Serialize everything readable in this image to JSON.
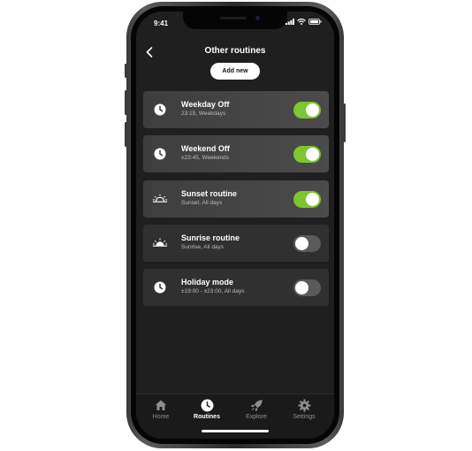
{
  "status_bar": {
    "time": "9:41"
  },
  "header": {
    "title": "Other routines",
    "back_icon": "chevron-left-icon",
    "add_new_label": "Add new"
  },
  "routines": [
    {
      "title": "Weekday Off",
      "subtitle": "23:15, Weekdays",
      "icon": "clock-icon",
      "enabled": true
    },
    {
      "title": "Weekend Off",
      "subtitle": "±23:45, Weekends",
      "icon": "clock-icon",
      "enabled": true
    },
    {
      "title": "Sunset routine",
      "subtitle": "Sunset, All days",
      "icon": "sunset-icon",
      "enabled": true
    },
    {
      "title": "Sunrise routine",
      "subtitle": "Sunrise, All days",
      "icon": "sunrise-icon",
      "enabled": false
    },
    {
      "title": "Holiday mode",
      "subtitle": "±19:00 - ±23:00, All days",
      "icon": "clock-icon",
      "enabled": false
    }
  ],
  "bottom_nav": {
    "items": [
      {
        "label": "Home",
        "icon": "house-icon",
        "active": false
      },
      {
        "label": "Routines",
        "icon": "clock-icon",
        "active": true
      },
      {
        "label": "Explore",
        "icon": "rocket-icon",
        "active": false
      },
      {
        "label": "Settings",
        "icon": "gear-icon",
        "active": false
      }
    ]
  },
  "colors": {
    "toggle_on": "#7cc62f",
    "toggle_off": "#5a5a5a",
    "screen_bg": "#1f1f1f",
    "card_bg": "#303030"
  }
}
